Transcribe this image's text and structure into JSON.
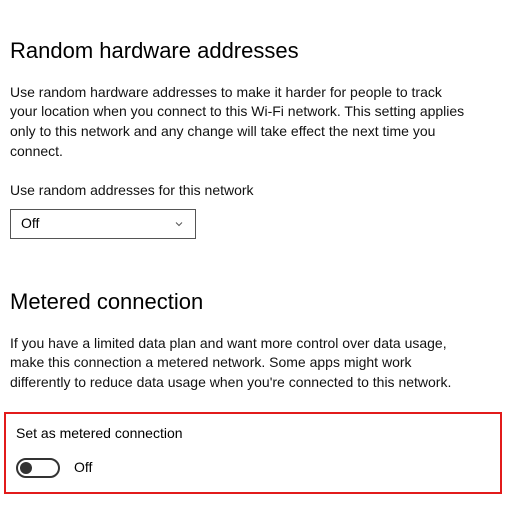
{
  "random_hw": {
    "heading": "Random hardware addresses",
    "description": "Use random hardware addresses to make it harder for people to track your location when you connect to this Wi-Fi network. This setting applies only to this network and any change will take effect the next time you connect.",
    "field_label": "Use random addresses for this network",
    "combo_value": "Off"
  },
  "metered": {
    "heading": "Metered connection",
    "description": "If you have a limited data plan and want more control over data usage, make this connection a metered network. Some apps might work differently to reduce data usage when you're connected to this network.",
    "toggle_label": "Set as metered connection",
    "toggle_state": "Off"
  }
}
